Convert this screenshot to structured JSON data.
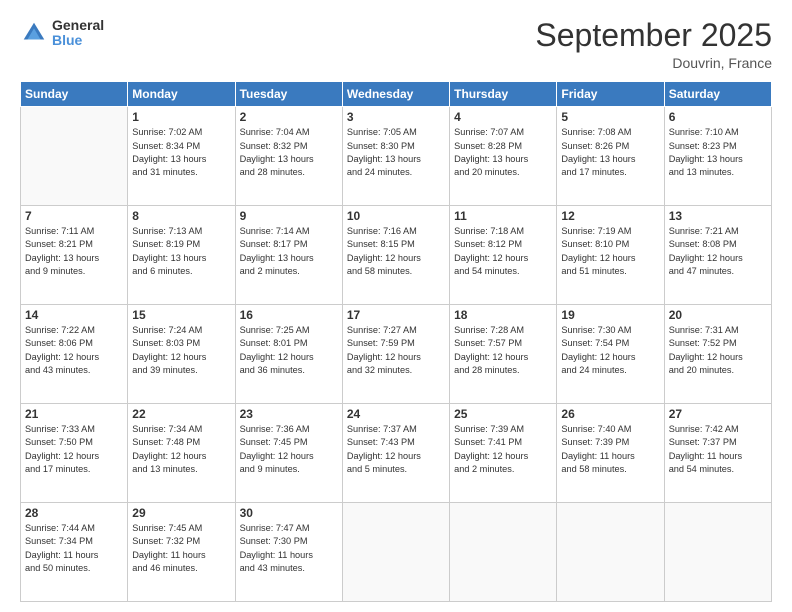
{
  "header": {
    "logo_line1": "General",
    "logo_line2": "Blue",
    "month": "September 2025",
    "location": "Douvrin, France"
  },
  "days_of_week": [
    "Sunday",
    "Monday",
    "Tuesday",
    "Wednesday",
    "Thursday",
    "Friday",
    "Saturday"
  ],
  "weeks": [
    [
      {
        "day": "",
        "info": ""
      },
      {
        "day": "1",
        "info": "Sunrise: 7:02 AM\nSunset: 8:34 PM\nDaylight: 13 hours\nand 31 minutes."
      },
      {
        "day": "2",
        "info": "Sunrise: 7:04 AM\nSunset: 8:32 PM\nDaylight: 13 hours\nand 28 minutes."
      },
      {
        "day": "3",
        "info": "Sunrise: 7:05 AM\nSunset: 8:30 PM\nDaylight: 13 hours\nand 24 minutes."
      },
      {
        "day": "4",
        "info": "Sunrise: 7:07 AM\nSunset: 8:28 PM\nDaylight: 13 hours\nand 20 minutes."
      },
      {
        "day": "5",
        "info": "Sunrise: 7:08 AM\nSunset: 8:26 PM\nDaylight: 13 hours\nand 17 minutes."
      },
      {
        "day": "6",
        "info": "Sunrise: 7:10 AM\nSunset: 8:23 PM\nDaylight: 13 hours\nand 13 minutes."
      }
    ],
    [
      {
        "day": "7",
        "info": "Sunrise: 7:11 AM\nSunset: 8:21 PM\nDaylight: 13 hours\nand 9 minutes."
      },
      {
        "day": "8",
        "info": "Sunrise: 7:13 AM\nSunset: 8:19 PM\nDaylight: 13 hours\nand 6 minutes."
      },
      {
        "day": "9",
        "info": "Sunrise: 7:14 AM\nSunset: 8:17 PM\nDaylight: 13 hours\nand 2 minutes."
      },
      {
        "day": "10",
        "info": "Sunrise: 7:16 AM\nSunset: 8:15 PM\nDaylight: 12 hours\nand 58 minutes."
      },
      {
        "day": "11",
        "info": "Sunrise: 7:18 AM\nSunset: 8:12 PM\nDaylight: 12 hours\nand 54 minutes."
      },
      {
        "day": "12",
        "info": "Sunrise: 7:19 AM\nSunset: 8:10 PM\nDaylight: 12 hours\nand 51 minutes."
      },
      {
        "day": "13",
        "info": "Sunrise: 7:21 AM\nSunset: 8:08 PM\nDaylight: 12 hours\nand 47 minutes."
      }
    ],
    [
      {
        "day": "14",
        "info": "Sunrise: 7:22 AM\nSunset: 8:06 PM\nDaylight: 12 hours\nand 43 minutes."
      },
      {
        "day": "15",
        "info": "Sunrise: 7:24 AM\nSunset: 8:03 PM\nDaylight: 12 hours\nand 39 minutes."
      },
      {
        "day": "16",
        "info": "Sunrise: 7:25 AM\nSunset: 8:01 PM\nDaylight: 12 hours\nand 36 minutes."
      },
      {
        "day": "17",
        "info": "Sunrise: 7:27 AM\nSunset: 7:59 PM\nDaylight: 12 hours\nand 32 minutes."
      },
      {
        "day": "18",
        "info": "Sunrise: 7:28 AM\nSunset: 7:57 PM\nDaylight: 12 hours\nand 28 minutes."
      },
      {
        "day": "19",
        "info": "Sunrise: 7:30 AM\nSunset: 7:54 PM\nDaylight: 12 hours\nand 24 minutes."
      },
      {
        "day": "20",
        "info": "Sunrise: 7:31 AM\nSunset: 7:52 PM\nDaylight: 12 hours\nand 20 minutes."
      }
    ],
    [
      {
        "day": "21",
        "info": "Sunrise: 7:33 AM\nSunset: 7:50 PM\nDaylight: 12 hours\nand 17 minutes."
      },
      {
        "day": "22",
        "info": "Sunrise: 7:34 AM\nSunset: 7:48 PM\nDaylight: 12 hours\nand 13 minutes."
      },
      {
        "day": "23",
        "info": "Sunrise: 7:36 AM\nSunset: 7:45 PM\nDaylight: 12 hours\nand 9 minutes."
      },
      {
        "day": "24",
        "info": "Sunrise: 7:37 AM\nSunset: 7:43 PM\nDaylight: 12 hours\nand 5 minutes."
      },
      {
        "day": "25",
        "info": "Sunrise: 7:39 AM\nSunset: 7:41 PM\nDaylight: 12 hours\nand 2 minutes."
      },
      {
        "day": "26",
        "info": "Sunrise: 7:40 AM\nSunset: 7:39 PM\nDaylight: 11 hours\nand 58 minutes."
      },
      {
        "day": "27",
        "info": "Sunrise: 7:42 AM\nSunset: 7:37 PM\nDaylight: 11 hours\nand 54 minutes."
      }
    ],
    [
      {
        "day": "28",
        "info": "Sunrise: 7:44 AM\nSunset: 7:34 PM\nDaylight: 11 hours\nand 50 minutes."
      },
      {
        "day": "29",
        "info": "Sunrise: 7:45 AM\nSunset: 7:32 PM\nDaylight: 11 hours\nand 46 minutes."
      },
      {
        "day": "30",
        "info": "Sunrise: 7:47 AM\nSunset: 7:30 PM\nDaylight: 11 hours\nand 43 minutes."
      },
      {
        "day": "",
        "info": ""
      },
      {
        "day": "",
        "info": ""
      },
      {
        "day": "",
        "info": ""
      },
      {
        "day": "",
        "info": ""
      }
    ]
  ]
}
